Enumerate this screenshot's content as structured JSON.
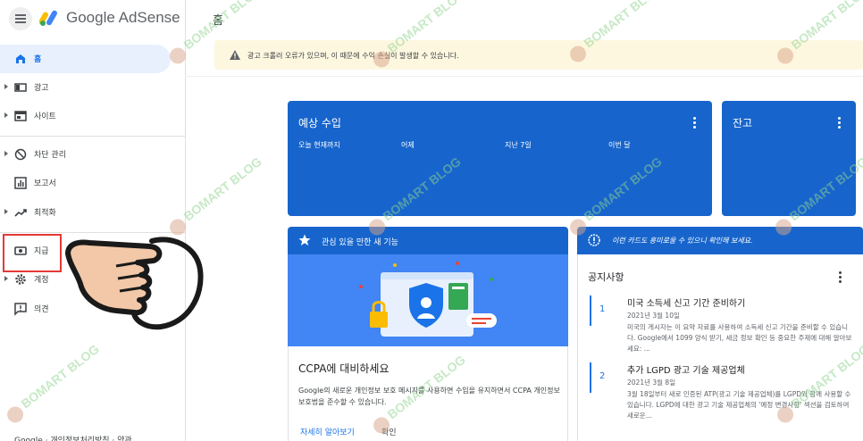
{
  "app": {
    "name": "Google AdSense",
    "page_title": "홈"
  },
  "sidebar": {
    "items": [
      {
        "label": "홈",
        "icon": "home-icon",
        "active": true
      },
      {
        "label": "광고",
        "icon": "ads-icon"
      },
      {
        "label": "사이트",
        "icon": "sites-icon"
      },
      {
        "label": "차단 관리",
        "icon": "block-icon"
      },
      {
        "label": "보고서",
        "icon": "reports-icon"
      },
      {
        "label": "최적화",
        "icon": "optimize-icon"
      },
      {
        "label": "지급",
        "icon": "payments-icon"
      },
      {
        "label": "계정",
        "icon": "gear-icon"
      },
      {
        "label": "의견",
        "icon": "feedback-icon"
      }
    ],
    "footer": "Google · 개인정보처리방침 · 약관"
  },
  "notice_banner": {
    "text": "광고 크롤러 오류가 있으며, 이 때문에 수익 손실이 발생할 수 있습니다."
  },
  "earnings": {
    "title": "예상 수입",
    "columns": [
      "오늘 현재까지",
      "어제",
      "지난 7일",
      "이번 달"
    ]
  },
  "balance": {
    "title": "잔고"
  },
  "feature_card": {
    "header": "관심 있을 만한 새 기능",
    "title": "CCPA에 대비하세요",
    "description": "Google의 새로운 개인정보 보호 메시지를 사용하면 수입을 유지하면서 CCPA 개인정보 보호법을 준수할 수 있습니다.",
    "link_label": "자세히 알아보기",
    "confirm_label": "확인"
  },
  "alert_card": {
    "text": "이런 카드도 흥미로울 수 있으니 확인해 보세요."
  },
  "notices": {
    "title": "공지사항",
    "items": [
      {
        "number": "1",
        "title": "미국 소득세 신고 기간 준비하기",
        "date": "2021년 3월 10일",
        "body": "미국의 게시자는 이 요약 자료를 사용하여 소득세 신고 기간을 준비할 수 있습니다. Google에서 1099 양식 받기, 세금 정보 확인 등 중요한 주제에 대해 알아보세요: ..."
      },
      {
        "number": "2",
        "title": "추가 LGPD 광고 기술 제공업체",
        "date": "2021년 3월 8일",
        "body": "3월 18일부터 새로 인증된 ATP(광고 기술 제공업체)를 LGPD와 함께 사용할 수 있습니다. LGPD에 대한 광고 기술 제공업체의 '예정 변경사항' 섹션을 검토하여 새로운..."
      }
    ]
  },
  "watermark_text": "BOMART BLOG",
  "colors": {
    "blue": "#1765cc",
    "accent": "#1a73e8",
    "banner": "#fef7e0",
    "highlight": "#e53935"
  }
}
